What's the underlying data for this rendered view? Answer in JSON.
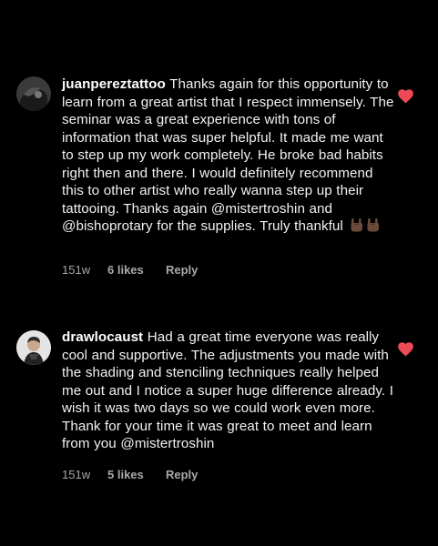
{
  "comments": [
    {
      "username": "juanpereztattoo",
      "text": "Thanks again for this opportunity to learn from a great artist that I respect immensely. The seminar was a great experience with tons of information that was super helpful. It made me want to step up my work completely. He broke bad habits right then and there. I would definitely recommend this to other artist who really wanna step up their tattooing. Thanks again @mistertroshin and @bishoprotary for the supplies. Truly thankful",
      "emojis": [
        "sign-of-horns-icon",
        "sign-of-horns-icon"
      ],
      "time": "151w",
      "likes": "6 likes",
      "reply": "Reply",
      "liked": true
    },
    {
      "username": "drawlocaust",
      "text": "Had a great time everyone was really cool and supportive. The adjustments you made with the shading and stenciling techniques really  helped me out and I notice a super huge difference already. I wish it was two days so we could work even more. Thank for your time it was great to meet and learn from you @mistertroshin",
      "time": "151w",
      "likes": "5 likes",
      "reply": "Reply",
      "liked": true
    }
  ],
  "colors": {
    "background": "#000000",
    "text": "#f2f2f2",
    "meta": "#a8a8a8",
    "heart": "#ed4956"
  }
}
